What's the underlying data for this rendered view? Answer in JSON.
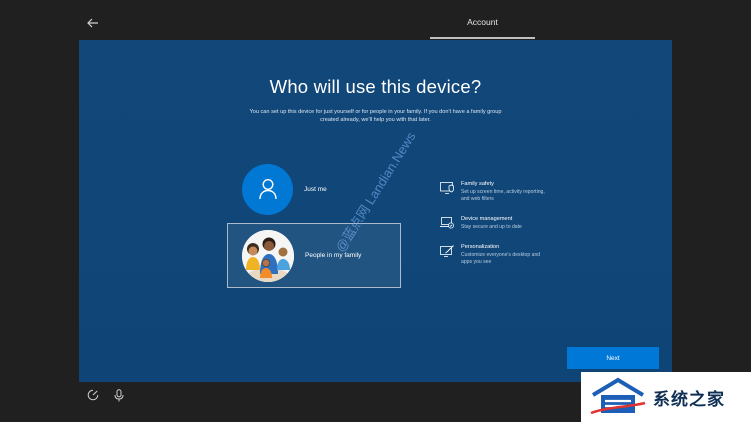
{
  "header": {
    "title": "Account"
  },
  "main": {
    "heading": "Who will use this device?",
    "subtext": "You can set up this device for just yourself or for people in your family. If you don't have a family group created already, we'll help you with that later."
  },
  "options": [
    {
      "label": "Just me",
      "icon": "person-icon"
    },
    {
      "label": "People in my family",
      "icon": "family-illustration"
    }
  ],
  "features": [
    {
      "title": "Family safety",
      "desc": "Set up screen time, activity reporting, and web filters",
      "icon": "shield-monitor-icon"
    },
    {
      "title": "Device management",
      "desc": "Stay secure and up to date",
      "icon": "laptop-check-icon"
    },
    {
      "title": "Personalization",
      "desc": "Customize everyone's desktop and apps you see",
      "icon": "brush-monitor-icon"
    }
  ],
  "actions": {
    "next_label": "Next"
  },
  "footer": {
    "left_icon": "accessibility-icon",
    "right_icon": "microphone-icon"
  },
  "overlays": {
    "watermark": "@蓝点网 Landian.News",
    "logo_text": "系统之家"
  },
  "colors": {
    "panel": "#0f4a7d",
    "accent": "#0078d7",
    "frame": "#202020"
  }
}
